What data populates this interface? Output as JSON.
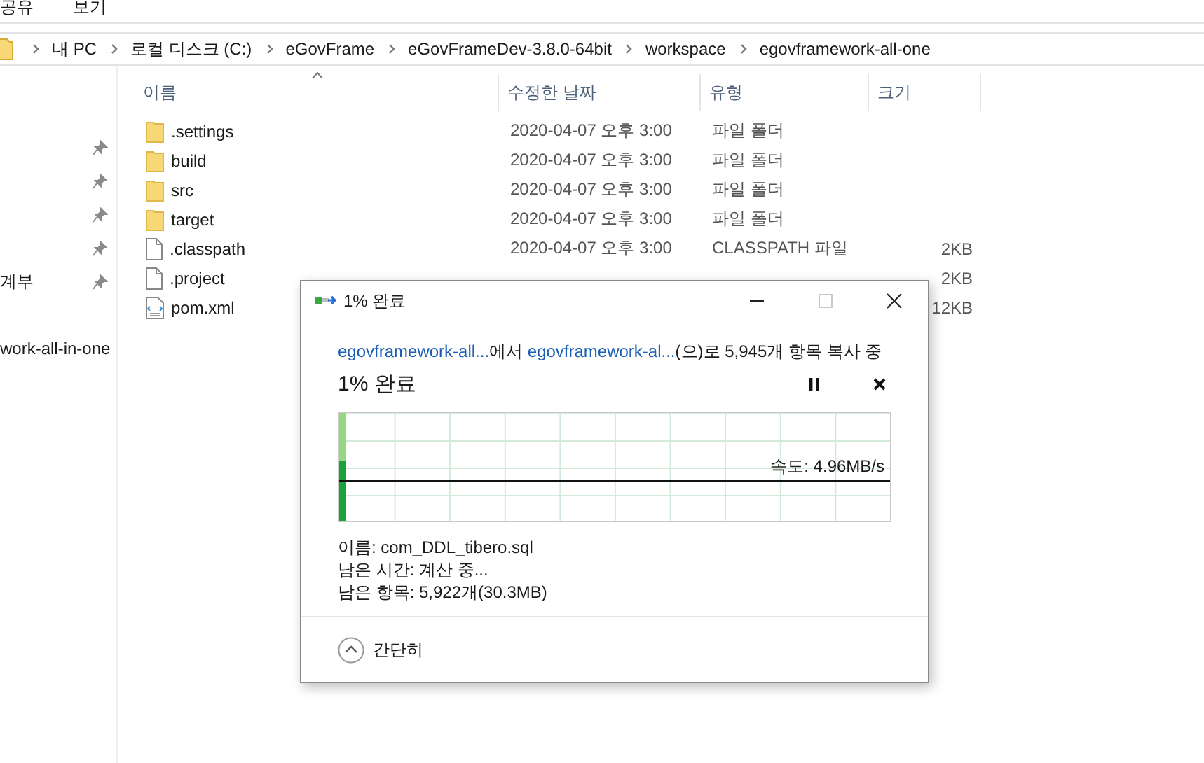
{
  "ribbon_tabs": [
    "공유",
    "보기"
  ],
  "address_bar": {
    "segments": [
      "내 PC",
      "로컬 디스크 (C:)",
      "eGovFrame",
      "eGovFrameDev-3.8.0-64bit",
      "workspace",
      "egovframework-all-one"
    ]
  },
  "nav_pane": {
    "items": [
      {
        "pinned": true
      },
      {
        "pinned": true
      },
      {
        "pinned": true
      },
      {
        "pinned": true
      },
      {
        "label": "계부",
        "pinned": true
      },
      {
        "label": "work-all-in-one",
        "pinned": false
      }
    ]
  },
  "file_list": {
    "columns": [
      "이름",
      "수정한 날짜",
      "유형",
      "크기"
    ],
    "rows": [
      {
        "kind": "folder",
        "name": ".settings",
        "date": "2020-04-07 오후 3:00",
        "type": "파일 폴더"
      },
      {
        "kind": "folder",
        "name": "build",
        "date": "2020-04-07 오후 3:00",
        "type": "파일 폴더"
      },
      {
        "kind": "folder",
        "name": "src",
        "date": "2020-04-07 오후 3:00",
        "type": "파일 폴더"
      },
      {
        "kind": "folder",
        "name": "target",
        "date": "2020-04-07 오후 3:00",
        "type": "파일 폴더"
      },
      {
        "kind": "file",
        "name": ".classpath",
        "date": "2020-04-07 오후 3:00",
        "type": "CLASSPATH 파일",
        "size": "2KB"
      },
      {
        "kind": "file",
        "name": ".project",
        "size": "2KB"
      },
      {
        "kind": "xml",
        "name": "pom.xml",
        "size": "12KB"
      }
    ]
  },
  "copy_dialog": {
    "title": "1% 완료",
    "source_link": "egovframework-all...",
    "from_text": "에서",
    "dest_link": "egovframework-al...",
    "summary": "(으)로 5,945개 항목 복사 중",
    "heading": "1% 완료",
    "graph": {
      "level": 0.012,
      "speed": "속도: 4.96MB/s"
    },
    "details": [
      "이름: com_DDL_tibero.sql",
      "남은 시간: 계산 중...",
      "남은 항목: 5,922개(30.3MB)"
    ],
    "toggle_label": "간단히"
  }
}
